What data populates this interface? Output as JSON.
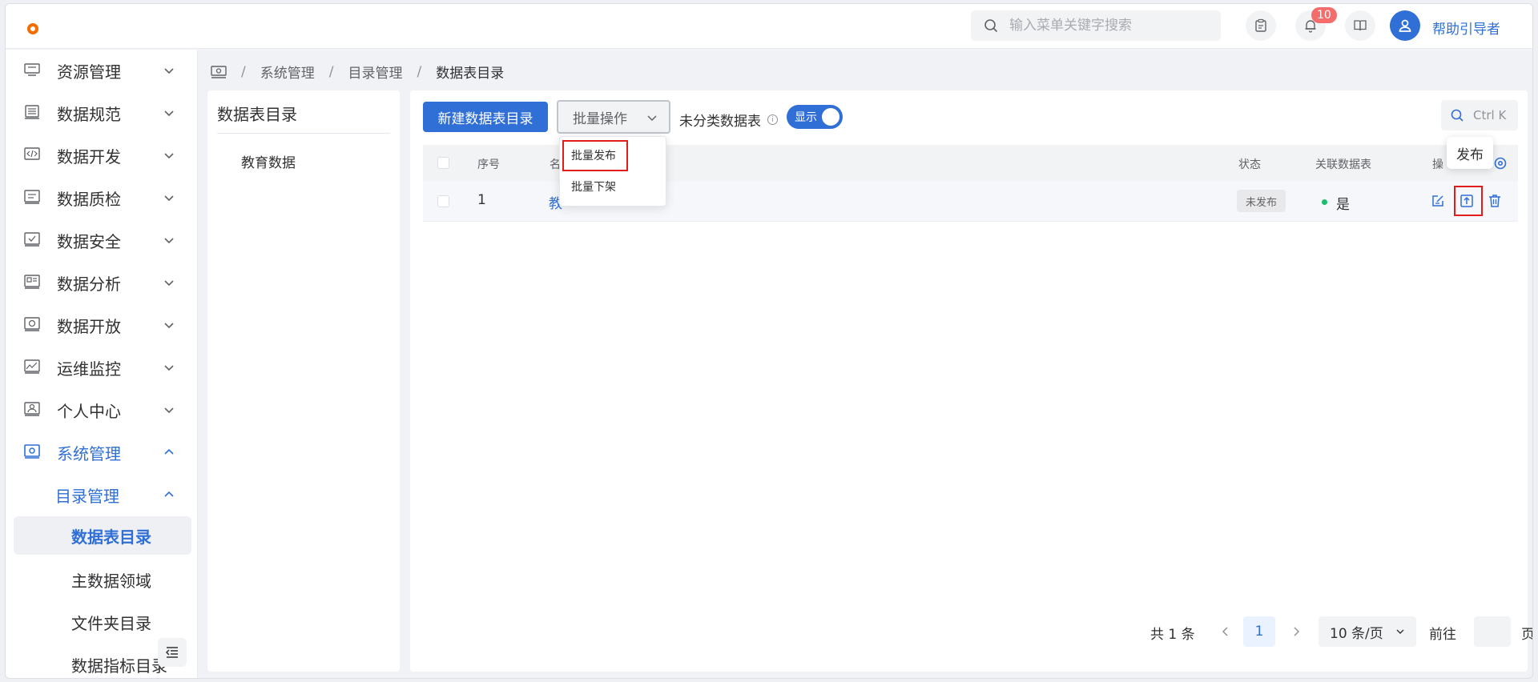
{
  "header": {
    "search_placeholder": "输入菜单关键字搜索",
    "notification_count": "10",
    "username": "帮助引导者"
  },
  "sidebar": {
    "items": [
      {
        "label": "资源管理",
        "icon": "server-icon"
      },
      {
        "label": "数据规范",
        "icon": "database-icon"
      },
      {
        "label": "数据开发",
        "icon": "code-icon"
      },
      {
        "label": "数据质检",
        "icon": "inspect-icon"
      },
      {
        "label": "数据安全",
        "icon": "shield-icon"
      },
      {
        "label": "数据分析",
        "icon": "analysis-icon"
      },
      {
        "label": "数据开放",
        "icon": "open-icon"
      },
      {
        "label": "运维监控",
        "icon": "monitor-icon"
      },
      {
        "label": "个人中心",
        "icon": "user-icon"
      },
      {
        "label": "系统管理",
        "icon": "settings-icon"
      }
    ],
    "sub_group": "目录管理",
    "sub_items": [
      "数据表目录",
      "主数据领域",
      "文件夹目录",
      "数据指标目录"
    ]
  },
  "breadcrumb": [
    "系统管理",
    "目录管理",
    "数据表目录"
  ],
  "left_panel": {
    "title": "数据表目录",
    "items": [
      "教育数据"
    ]
  },
  "toolbar": {
    "new_button": "新建数据表目录",
    "batch_button": "批量操作",
    "unclassified_label": "未分类数据表",
    "toggle_label": "显示",
    "search_shortcut": "Ctrl K"
  },
  "dropdown": {
    "items": [
      "批量发布",
      "批量下架"
    ]
  },
  "table": {
    "columns": [
      "序号",
      "名",
      "状态",
      "关联数据表",
      "操"
    ],
    "rows": [
      {
        "index": "1",
        "name": "教",
        "status": "未发布",
        "linked": "是"
      }
    ]
  },
  "tooltip": "发布",
  "pagination": {
    "total": "共 1 条",
    "current_page": "1",
    "page_size": "10 条/页",
    "goto_label": "前往",
    "page_suffix": "页"
  },
  "colors": {
    "primary": "#2f6fd6",
    "highlight": "#e21b1b",
    "status_dot": "#19be6b",
    "badge": "#f56c6c"
  }
}
